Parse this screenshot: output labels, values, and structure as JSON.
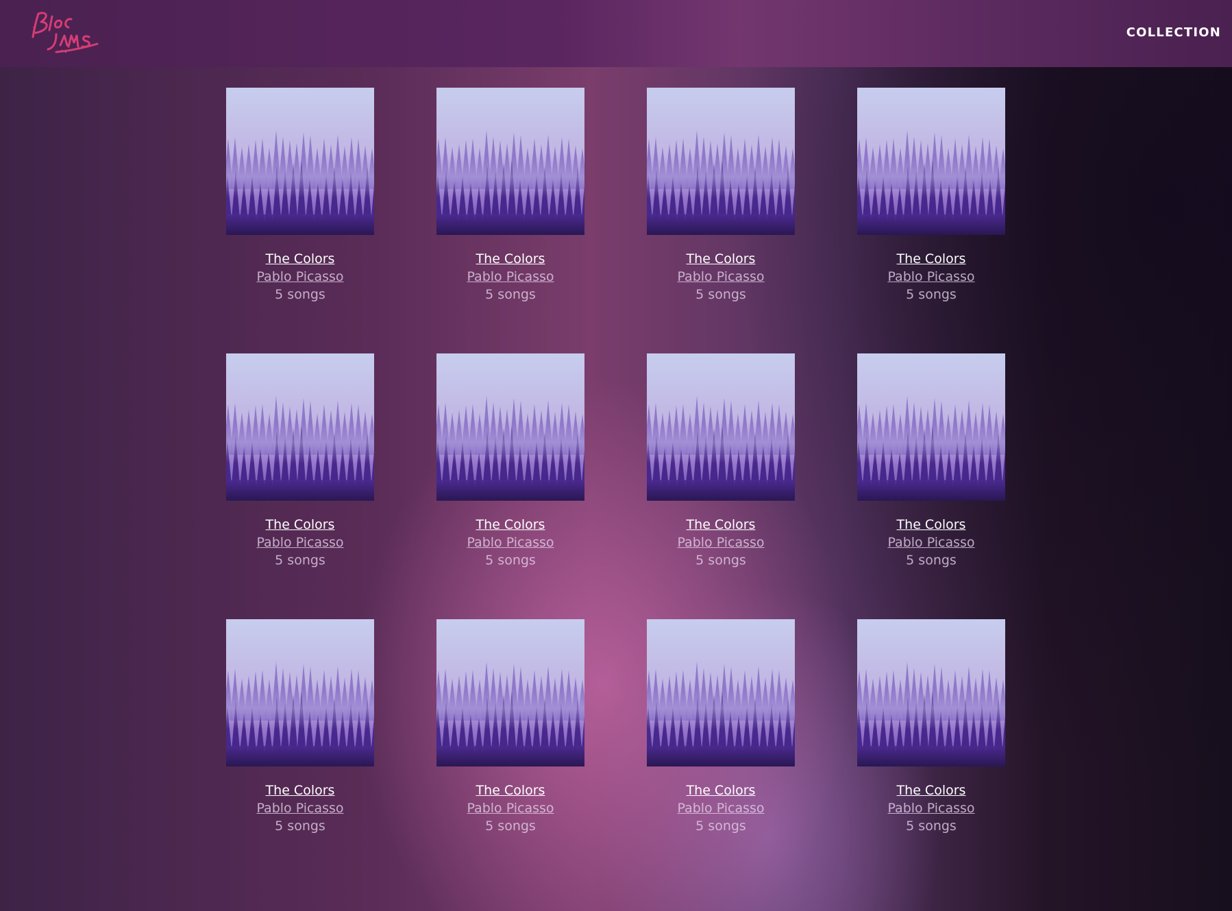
{
  "header": {
    "logo_text": "Bloc Jams",
    "nav_collection": "COLLECTION"
  },
  "colors": {
    "header_bg": "#5a2660",
    "logo": "#d63d74",
    "title_text": "#ffffff",
    "secondary_text": "#e6d2eb"
  },
  "albums": [
    {
      "title": "The Colors",
      "artist": "Pablo Picasso",
      "songs": "5 songs"
    },
    {
      "title": "The Colors",
      "artist": "Pablo Picasso",
      "songs": "5 songs"
    },
    {
      "title": "The Colors",
      "artist": "Pablo Picasso",
      "songs": "5 songs"
    },
    {
      "title": "The Colors",
      "artist": "Pablo Picasso",
      "songs": "5 songs"
    },
    {
      "title": "The Colors",
      "artist": "Pablo Picasso",
      "songs": "5 songs"
    },
    {
      "title": "The Colors",
      "artist": "Pablo Picasso",
      "songs": "5 songs"
    },
    {
      "title": "The Colors",
      "artist": "Pablo Picasso",
      "songs": "5 songs"
    },
    {
      "title": "The Colors",
      "artist": "Pablo Picasso",
      "songs": "5 songs"
    },
    {
      "title": "The Colors",
      "artist": "Pablo Picasso",
      "songs": "5 songs"
    },
    {
      "title": "The Colors",
      "artist": "Pablo Picasso",
      "songs": "5 songs"
    },
    {
      "title": "The Colors",
      "artist": "Pablo Picasso",
      "songs": "5 songs"
    },
    {
      "title": "The Colors",
      "artist": "Pablo Picasso",
      "songs": "5 songs"
    }
  ]
}
